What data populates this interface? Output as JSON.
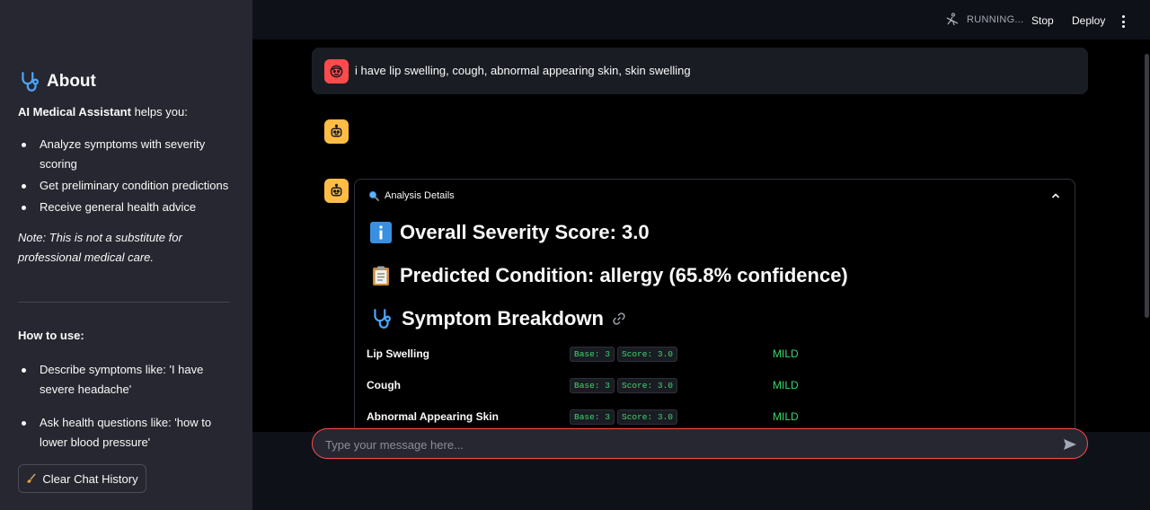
{
  "sidebar": {
    "about_title": "About",
    "intro_bold": "AI Medical Assistant",
    "intro_rest": " helps you:",
    "features": [
      "Analyze symptoms with severity scoring",
      "Get preliminary condition predictions",
      "Receive general health advice"
    ],
    "note": "Note: This is not a substitute for professional medical care.",
    "how_to_title": "How to use:",
    "how_to": [
      "Describe symptoms like: 'I have severe headache'",
      "Ask health questions like: 'how to lower blood pressure'"
    ],
    "clear_button": "Clear Chat History"
  },
  "topbar": {
    "status": "RUNNING...",
    "stop": "Stop",
    "deploy": "Deploy"
  },
  "chat": {
    "user_message": "i have lip swelling, cough, abnormal appearing skin, skin swelling",
    "expander_label": "Analysis Details",
    "severity_heading": "Overall Severity Score: 3.0",
    "condition_heading": "Predicted Condition: allergy (65.8% confidence)",
    "breakdown_heading": "Symptom Breakdown",
    "symptoms": [
      {
        "name": "Lip Swelling",
        "base": "Base: 3",
        "score": "Score: 3.0",
        "level": "MILD"
      },
      {
        "name": "Cough",
        "base": "Base: 3",
        "score": "Score: 3.0",
        "level": "MILD"
      },
      {
        "name": "Abnormal Appearing Skin",
        "base": "Base: 3",
        "score": "Score: 3.0",
        "level": "MILD"
      }
    ],
    "input_placeholder": "Type your message here..."
  },
  "colors": {
    "sidebar_bg": "#262730",
    "accent": "#ff4b4b",
    "bot_avatar": "#ffbd45",
    "mild": "#3dd56d"
  }
}
